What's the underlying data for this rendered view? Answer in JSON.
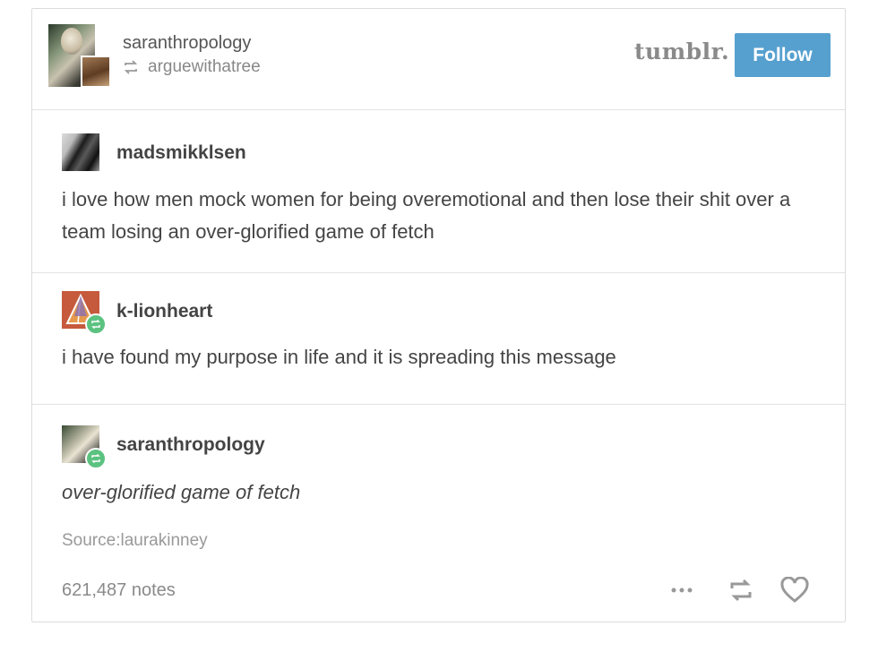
{
  "header": {
    "blog_name": "saranthropology",
    "reblogged_from": "arguewithatree",
    "brand": "tumblr.",
    "follow_label": "Follow"
  },
  "trail": [
    {
      "username": "madsmikklsen",
      "text": "i love how men mock women for being overemotional and then lose their shit over a team losing an over-glorified game of fetch"
    },
    {
      "username": "k-lionheart",
      "text": "i have found my purpose in life and it is spreading this message"
    },
    {
      "username": "saranthropology",
      "text": "over-glorified game of fetch"
    }
  ],
  "footer": {
    "source": "Source:laurakinney",
    "notes": "621,487 notes"
  },
  "icons": {
    "reblog": "reblog-icon",
    "more": "more-icon",
    "like": "heart-icon",
    "badge": "reblog-badge-icon"
  },
  "colors": {
    "follow_button": "#56a0cf",
    "badge": "#5cc280"
  }
}
